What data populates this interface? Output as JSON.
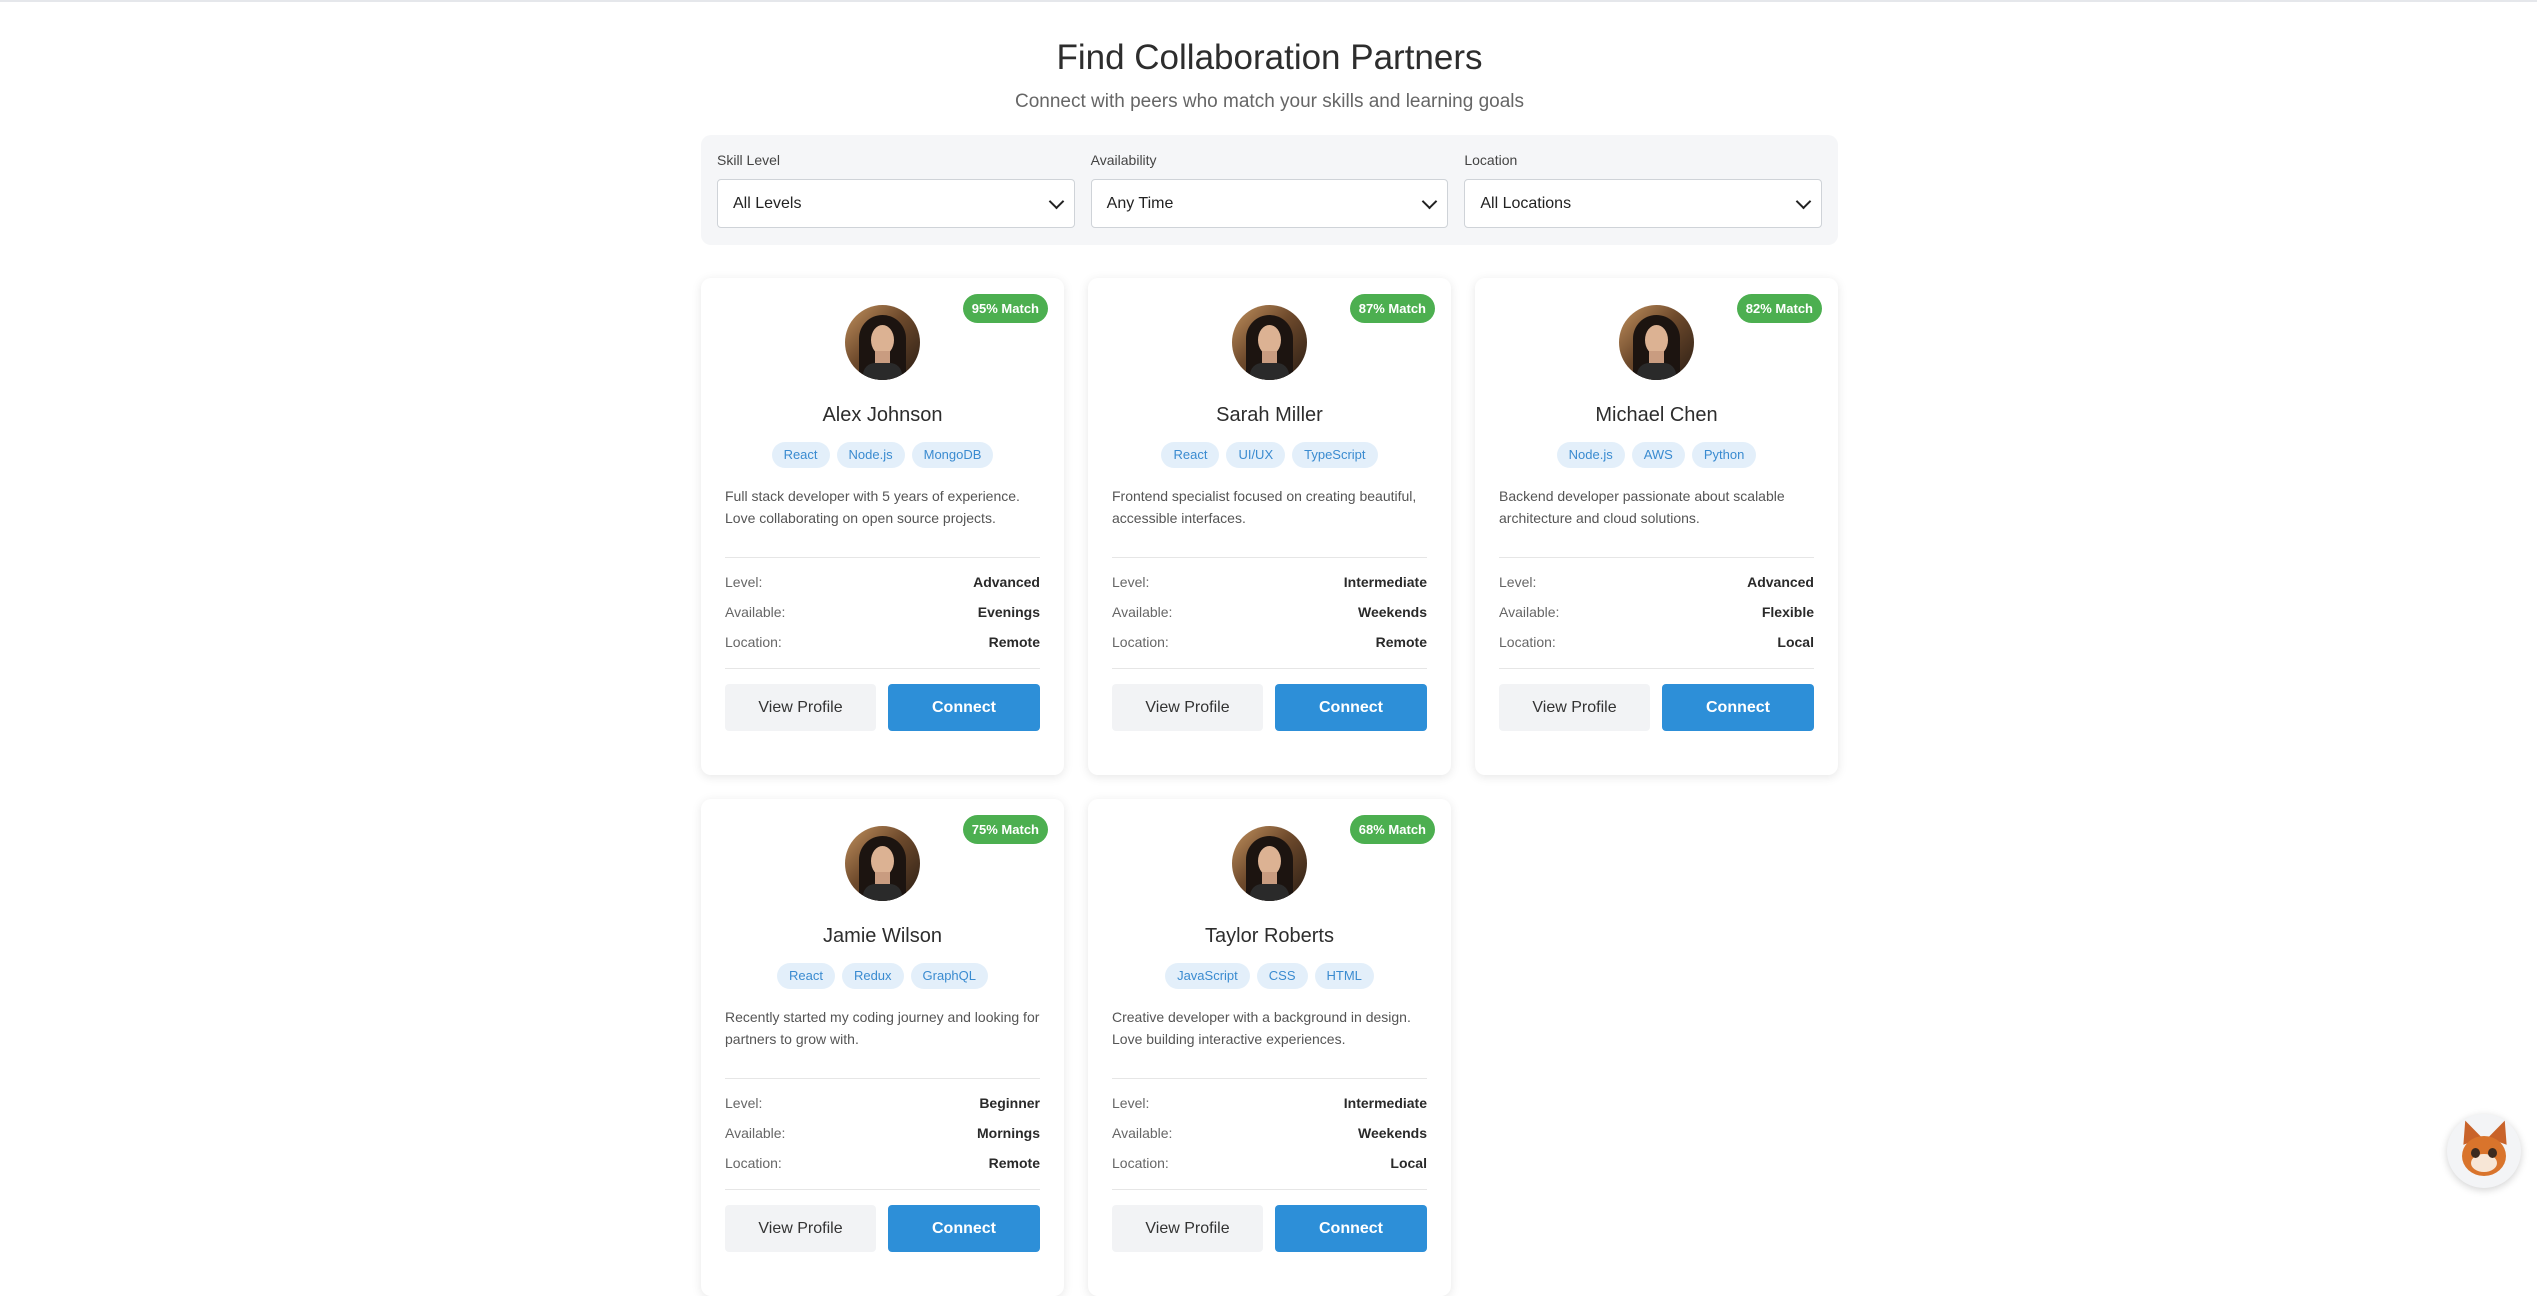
{
  "header": {
    "title": "Find Collaboration Partners",
    "subtitle": "Connect with peers who match your skills and learning goals"
  },
  "filters": [
    {
      "label": "Skill Level",
      "value": "All Levels"
    },
    {
      "label": "Availability",
      "value": "Any Time"
    },
    {
      "label": "Location",
      "value": "All Locations"
    }
  ],
  "field_labels": {
    "level": "Level:",
    "available": "Available:",
    "location": "Location:"
  },
  "buttons": {
    "view_profile": "View Profile",
    "connect": "Connect"
  },
  "cards": [
    {
      "match": "95% Match",
      "name": "Alex Johnson",
      "tags": [
        "React",
        "Node.js",
        "MongoDB"
      ],
      "bio": "Full stack developer with 5 years of experience. Love collaborating on open source projects.",
      "level": "Advanced",
      "available": "Evenings",
      "location": "Remote"
    },
    {
      "match": "87% Match",
      "name": "Sarah Miller",
      "tags": [
        "React",
        "UI/UX",
        "TypeScript"
      ],
      "bio": "Frontend specialist focused on creating beautiful, accessible interfaces.",
      "level": "Intermediate",
      "available": "Weekends",
      "location": "Remote"
    },
    {
      "match": "82% Match",
      "name": "Michael Chen",
      "tags": [
        "Node.js",
        "AWS",
        "Python"
      ],
      "bio": "Backend developer passionate about scalable architecture and cloud solutions.",
      "level": "Advanced",
      "available": "Flexible",
      "location": "Local"
    },
    {
      "match": "75% Match",
      "name": "Jamie Wilson",
      "tags": [
        "React",
        "Redux",
        "GraphQL"
      ],
      "bio": "Recently started my coding journey and looking for partners to grow with.",
      "level": "Beginner",
      "available": "Mornings",
      "location": "Remote"
    },
    {
      "match": "68% Match",
      "name": "Taylor Roberts",
      "tags": [
        "JavaScript",
        "CSS",
        "HTML"
      ],
      "bio": "Creative developer with a background in design. Love building interactive experiences.",
      "level": "Intermediate",
      "available": "Weekends",
      "location": "Local"
    }
  ],
  "colors": {
    "match_badge": "#4caf50",
    "connect_button": "#2d8fd8",
    "tag_bg": "#e3effa",
    "tag_text": "#3a8bd0"
  },
  "icons": {
    "assistant": "fox-mascot-icon",
    "select": "chevron-down-icon"
  }
}
